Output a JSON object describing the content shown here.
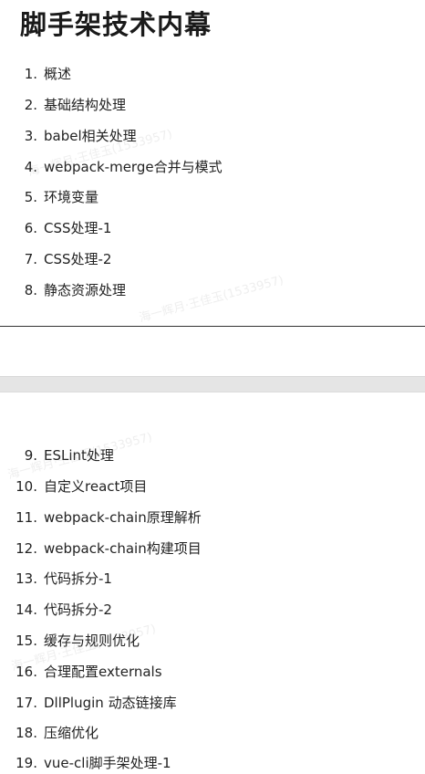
{
  "document": {
    "title": "脚手架技术内幕"
  },
  "toc_page_1": [
    {
      "num": "1.",
      "text": "概述"
    },
    {
      "num": "2.",
      "text": "基础结构处理"
    },
    {
      "num": "3.",
      "text": "babel相关处理"
    },
    {
      "num": "4.",
      "text": "webpack-merge合并与模式"
    },
    {
      "num": "5.",
      "text": "环境变量"
    },
    {
      "num": "6.",
      "text": "CSS处理-1"
    },
    {
      "num": "7.",
      "text": "CSS处理-2"
    },
    {
      "num": "8.",
      "text": "静态资源处理"
    }
  ],
  "toc_page_2": [
    {
      "num": "9.",
      "text": "ESLint处理"
    },
    {
      "num": "10.",
      "text": "自定义react项目"
    },
    {
      "num": "11.",
      "text": "webpack-chain原理解析"
    },
    {
      "num": "12.",
      "text": "webpack-chain构建项目"
    },
    {
      "num": "13.",
      "text": "代码拆分-1"
    },
    {
      "num": "14.",
      "text": "代码拆分-2"
    },
    {
      "num": "15.",
      "text": "缓存与规则优化"
    },
    {
      "num": "16.",
      "text": "合理配置externals"
    },
    {
      "num": "17.",
      "text": "DllPlugin 动态链接库"
    },
    {
      "num": "18.",
      "text": "压缩优化"
    },
    {
      "num": "19.",
      "text": "vue-cli脚手架处理-1"
    }
  ],
  "watermark": {
    "text": "海一辉月·王佳玉(1533957)"
  }
}
